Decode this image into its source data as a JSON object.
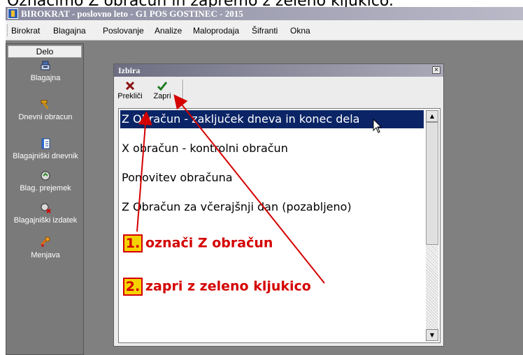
{
  "caption": "Označimo Z obračun in zapremo z zeleno kljukico.",
  "window": {
    "title": "BIROKRAT - poslovno leto - G1 POS GOSTINEC - 2015"
  },
  "menu": {
    "items": [
      "Birokrat",
      "Blagajna",
      "Poslovanje",
      "Analize",
      "Maloprodaja",
      "Šifranti",
      "Okna"
    ]
  },
  "sidebar": {
    "header": "Delo",
    "items": [
      {
        "label": "Blagajna",
        "icon": "cash-register-icon"
      },
      {
        "label": "Dnevni obracun",
        "icon": "hammer-icon"
      },
      {
        "label": "Blagajniški dnevnik",
        "icon": "journal-icon"
      },
      {
        "label": "Blag. prejemek",
        "icon": "receipt-icon"
      },
      {
        "label": "Blagajniški izdatek",
        "icon": "expense-icon"
      },
      {
        "label": "Menjava",
        "icon": "exchange-icon"
      }
    ]
  },
  "dialog": {
    "title": "Izbira",
    "close": "×",
    "toolbar": {
      "cancel_label": "Prekliči",
      "close_label": "Zapri"
    },
    "options": [
      "Z Obračun - zaključek dneva in konec dela",
      "X obračun - kontrolni obračun",
      "Ponovitev obračuna",
      "Z Obračun za včerajšnji dan (pozabljeno)"
    ],
    "selected_index": 0
  },
  "annotations": {
    "step1_num": "1.",
    "step1_text": "označi Z obračun",
    "step2_num": "2.",
    "step2_text": "zapri z zeleno kljukico",
    "color": "#d40000",
    "highlight": "#f6d300"
  },
  "colors": {
    "selection": "#0a2466",
    "workspace": "#808080"
  }
}
